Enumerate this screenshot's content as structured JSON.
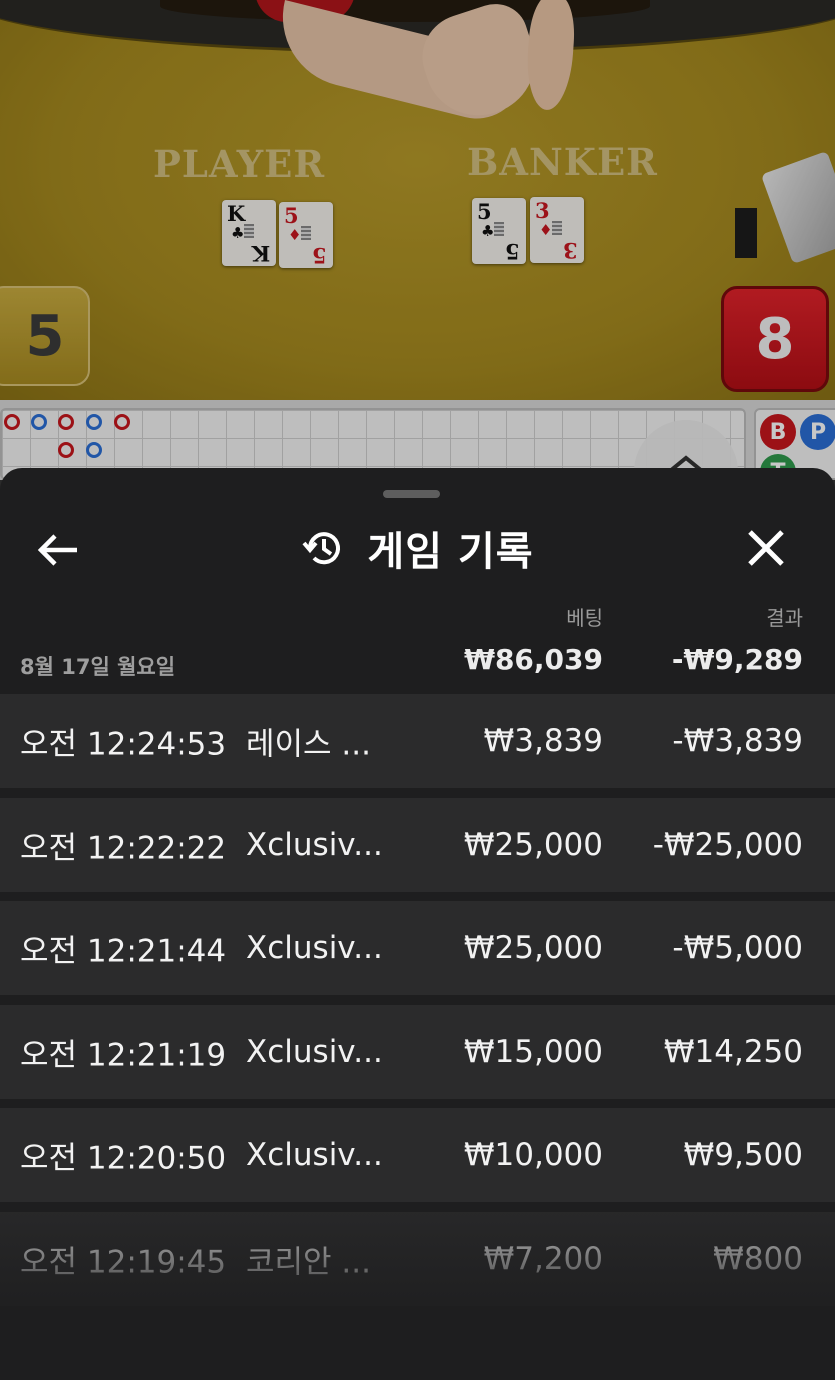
{
  "table": {
    "player_label": "PLAYER",
    "banker_label": "BANKER",
    "player_cards": [
      {
        "rank": "K",
        "suit": "♣",
        "color": "black"
      },
      {
        "rank": "5",
        "suit": "♦",
        "color": "red"
      }
    ],
    "banker_cards": [
      {
        "rank": "5",
        "suit": "♣",
        "color": "black"
      },
      {
        "rank": "3",
        "suit": "♦",
        "color": "red"
      }
    ],
    "player_score": "5",
    "banker_score": "8"
  },
  "roadmap": {
    "side_badges": [
      "B",
      "P",
      "T"
    ]
  },
  "sheet": {
    "title": "게임 기록",
    "back_icon": "arrow-left-icon",
    "history_icon": "history-icon",
    "close_icon": "close-icon",
    "column_bet": "베팅",
    "column_result": "결과",
    "date": "8월 17일 월요일",
    "total_bet": "₩86,039",
    "total_result": "-₩9,289",
    "rows": [
      {
        "time": "오전 12:24:53",
        "game": "레이스 ...",
        "bet": "₩3,839",
        "result": "-₩3,839"
      },
      {
        "time": "오전 12:22:22",
        "game": "Xclusiv...",
        "bet": "₩25,000",
        "result": "-₩25,000"
      },
      {
        "time": "오전 12:21:44",
        "game": "Xclusiv...",
        "bet": "₩25,000",
        "result": "-₩5,000"
      },
      {
        "time": "오전 12:21:19",
        "game": "Xclusiv...",
        "bet": "₩15,000",
        "result": "₩14,250"
      },
      {
        "time": "오전 12:20:50",
        "game": "Xclusiv...",
        "bet": "₩10,000",
        "result": "₩9,500"
      },
      {
        "time": "오전 12:19:45",
        "game": "코리안 ...",
        "bet": "₩7,200",
        "result": "₩800"
      }
    ]
  },
  "colors": {
    "sheet_bg": "#1e1e1f",
    "row_bg": "#2b2b2c",
    "banker_red": "#c8161d",
    "player_blue": "#2b6fd6",
    "table_felt": "#a68a1f"
  }
}
